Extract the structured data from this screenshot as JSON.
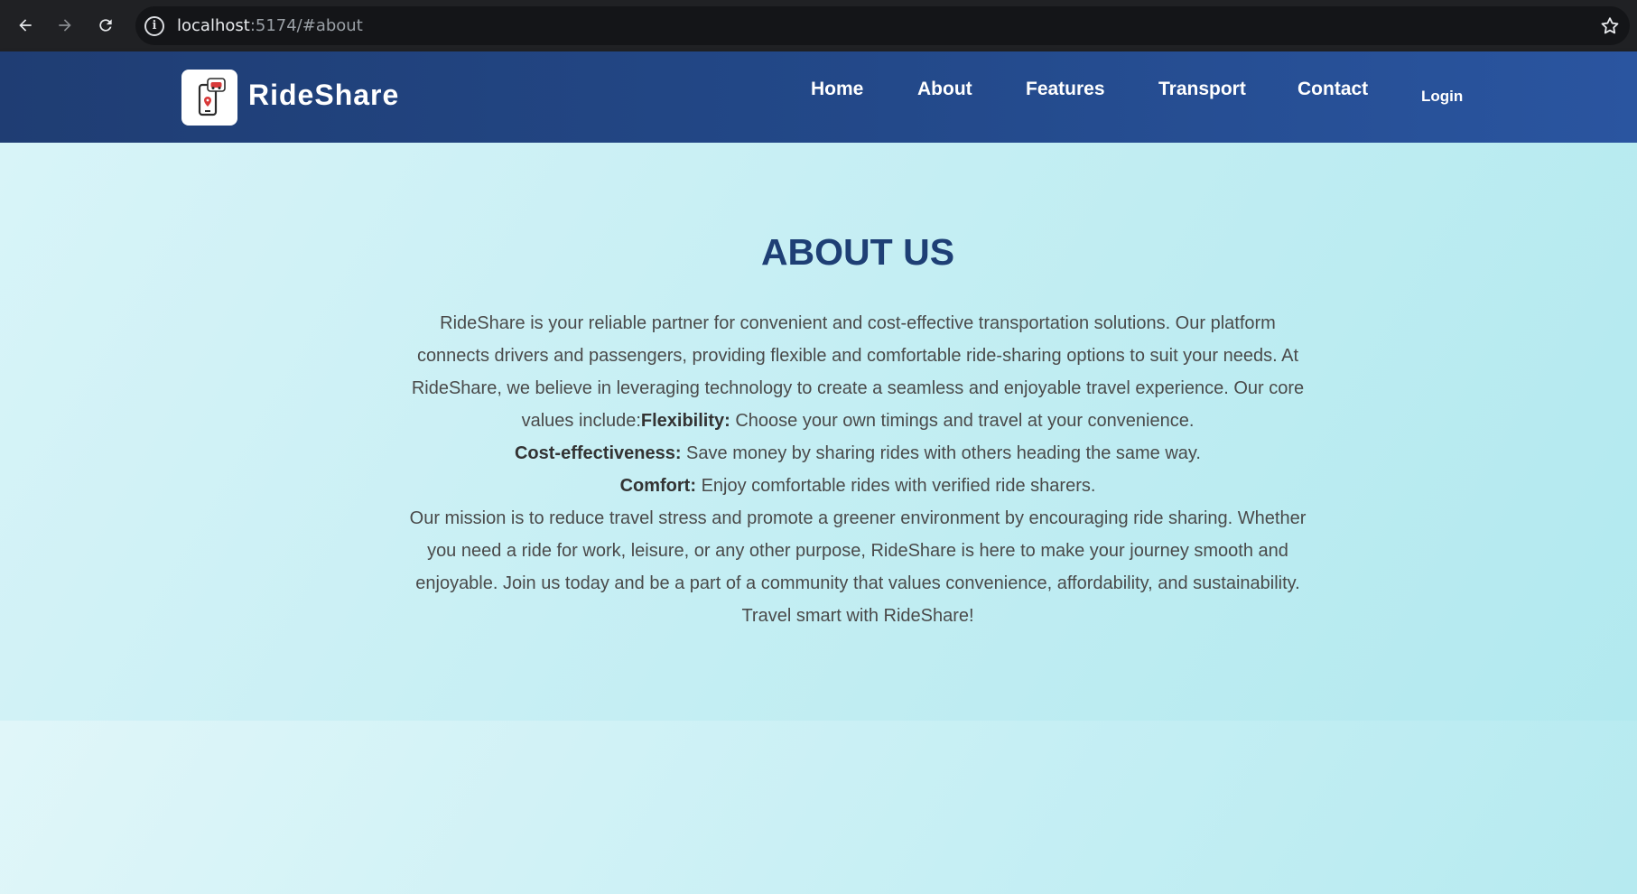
{
  "browser": {
    "url_host": "localhost",
    "url_path": ":5174/#about",
    "back_icon": "arrow-left-icon",
    "forward_icon": "arrow-right-icon",
    "reload_icon": "reload-icon",
    "info_icon": "info-icon",
    "bookmark_icon": "star-icon"
  },
  "header": {
    "brand": "RideShare",
    "logo_icon": "phone-car-location-icon",
    "nav": [
      "Home",
      "About",
      "Features",
      "Transport",
      "Contact"
    ],
    "login": "Login",
    "colors": {
      "header_bg": "#23498a",
      "text": "#ffffff"
    }
  },
  "about": {
    "title": "ABOUT US",
    "intro": "RideShare is your reliable partner for convenient and cost-effective transportation solutions. Our platform connects drivers and passengers, providing flexible and comfortable ride-sharing options to suit your needs. At RideShare, we believe in leveraging technology to create a seamless and enjoyable travel experience. Our core values include:",
    "values": [
      {
        "name": "Flexibility:",
        "text": " Choose your own timings and travel at your convenience."
      },
      {
        "name": "Cost-effectiveness:",
        "text": " Save money by sharing rides with others heading the same way."
      },
      {
        "name": "Comfort:",
        "text": " Enjoy comfortable rides with verified ride sharers."
      }
    ],
    "mission": "Our mission is to reduce travel stress and promote a greener environment by encouraging ride sharing. Whether you need a ride for work, leisure, or any other purpose, RideShare is here to make your journey smooth and enjoyable. Join us today and be a part of a community that values convenience, affordability, and sustainability. Travel smart with RideShare!",
    "colors": {
      "title": "#1e3f75",
      "body": "#4a4a4a"
    }
  }
}
